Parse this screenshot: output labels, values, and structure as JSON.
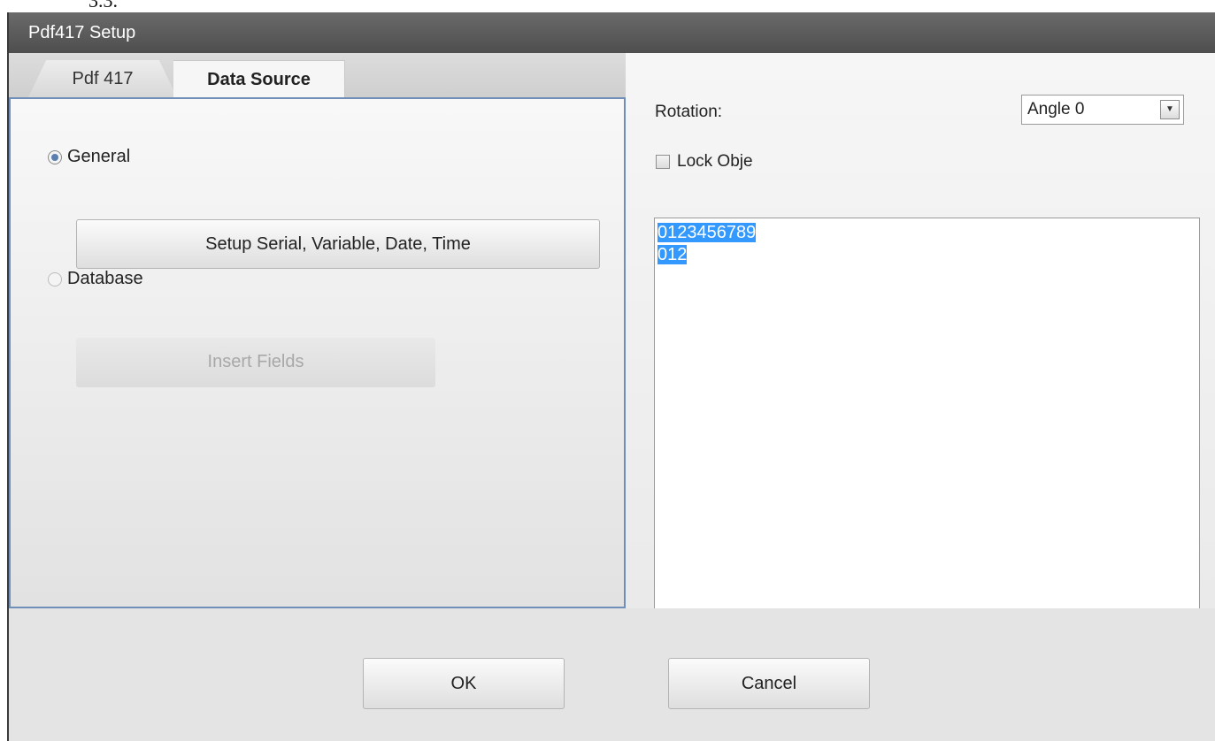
{
  "page_fragment": "3.3.",
  "window": {
    "title": "Pdf417 Setup"
  },
  "tabs": [
    {
      "label": "Pdf 417",
      "active": false
    },
    {
      "label": "Data Source",
      "active": true
    }
  ],
  "data_source": {
    "general": {
      "label": "General",
      "checked": true
    },
    "setup_button": {
      "label": "Setup Serial, Variable, Date, Time"
    },
    "database": {
      "label": "Database",
      "checked": false,
      "enabled": false
    },
    "insert_button": {
      "label": "Insert Fields",
      "enabled": false
    }
  },
  "right_panel": {
    "rotation_label": "Rotation:",
    "rotation_value": "Angle 0",
    "lock_label": "Lock Obje",
    "lock_checked": false,
    "data_lines": [
      "0123456789",
      "012"
    ],
    "selection_color": "#3399ff"
  },
  "footer": {
    "ok_label": "OK",
    "cancel_label": "Cancel"
  }
}
